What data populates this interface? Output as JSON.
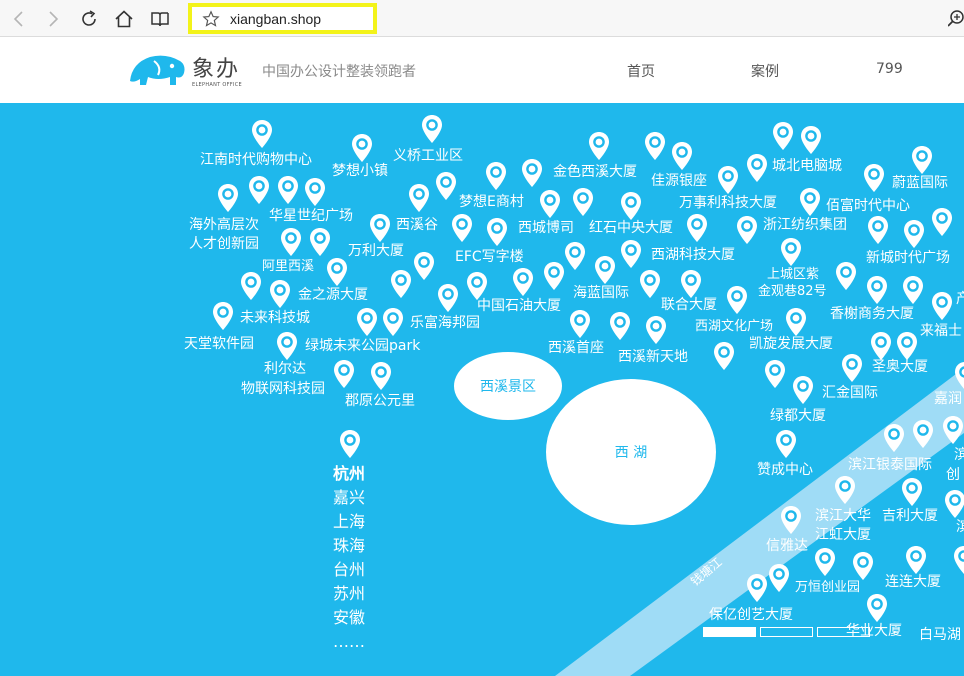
{
  "browser": {
    "url": "xiangban.shop",
    "icons": [
      "back-icon",
      "forward-icon",
      "reload-icon",
      "home-icon",
      "reading-view-icon",
      "favorite-star-icon",
      "zoom-icon"
    ]
  },
  "header": {
    "logo_chinese": "象办",
    "logo_english": "ELEPHANT OFFICE",
    "tagline": "中国办公设计整装领跑者",
    "nav": [
      "首页",
      "案例",
      "799"
    ]
  },
  "map": {
    "colors": {
      "background": "#1fb8ec",
      "river": "#9fdcf6",
      "lake": "#ffffff"
    },
    "lakes": [
      {
        "label": "西溪景区"
      },
      {
        "label": "西 湖"
      }
    ],
    "river_label": "钱塘江",
    "buildings": [
      "江南时代购物中心",
      "梦想小镇",
      "义桥工业区",
      "金色西溪大厦",
      "佳源银座",
      "城北电脑城",
      "蔚蓝国际",
      "梦想E商村",
      "万事利科技大厦",
      "佰富时代中心",
      "海外高层次",
      "人才创新园",
      "华星世纪广场",
      "西溪谷",
      "西城博司",
      "红石中央大厦",
      "浙江纺织集团",
      "万利大厦",
      "EFC写字楼",
      "西湖科技大厦",
      "新城时代广场",
      "阿里西溪",
      "上城区紫",
      "金观巷82号",
      "金之源大厦",
      "海蓝国际",
      "中国石油大厦",
      "联合大厦",
      "乐富海邦园",
      "未来科技城",
      "西湖文化广场",
      "香榭商务大厦",
      "来福士",
      "天堂软件园",
      "绿城未来公园park",
      "西溪首座",
      "西溪新天地",
      "凯旋发展大厦",
      "利尔达",
      "物联网科技园",
      "郡原公元里",
      "汇金国际",
      "圣奥大厦",
      "嘉润",
      "绿都大厦",
      "赞成中心",
      "滨江银泰国际",
      "滨江大华",
      "吉利大厦",
      "江虹大厦",
      "信雅达",
      "万恒创业园",
      "连连大厦",
      "保亿创艺大厦",
      "华业大厦",
      "白马湖"
    ],
    "partial_labels": [
      "产",
      "滨",
      "创",
      "滨"
    ],
    "cities": [
      "杭州",
      "嘉兴",
      "上海",
      "珠海",
      "台州",
      "苏州",
      "安徽",
      "……"
    ]
  }
}
